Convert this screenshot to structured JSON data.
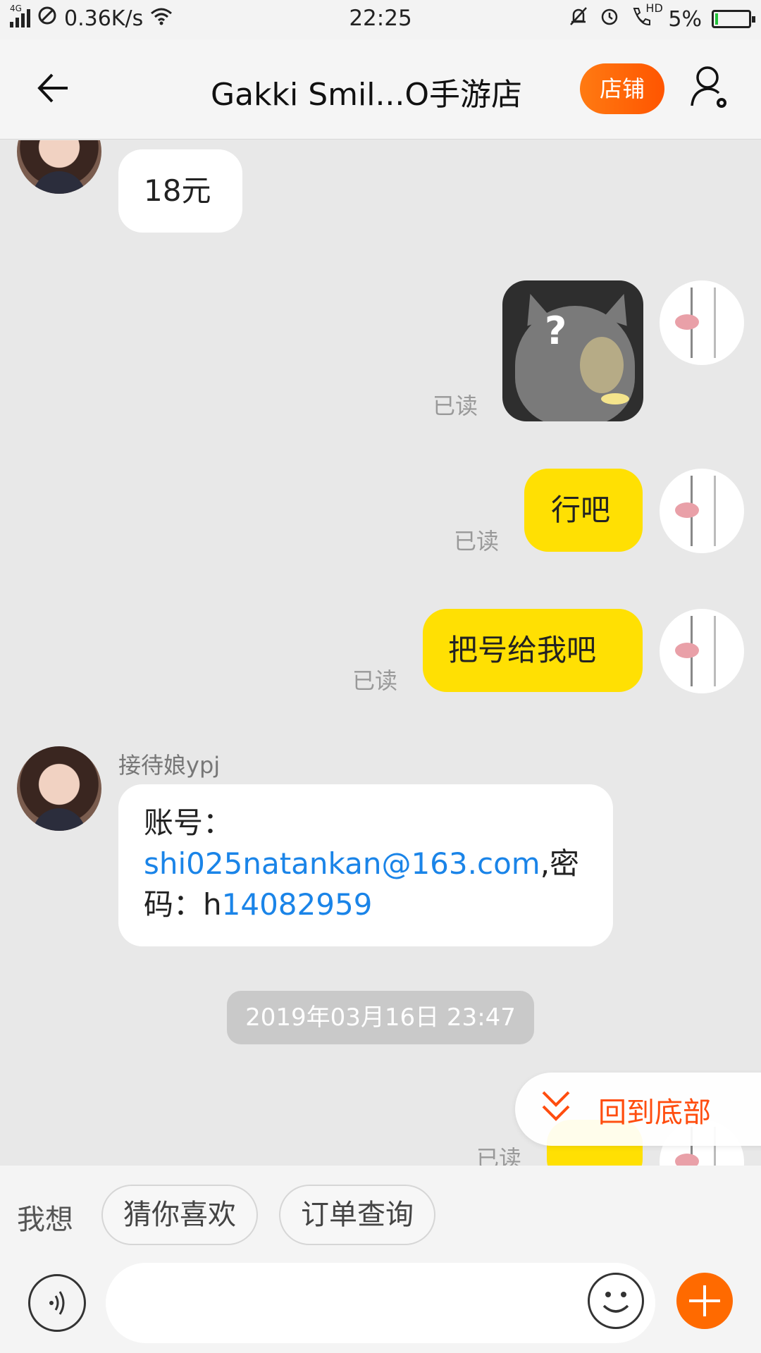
{
  "status_bar": {
    "network_type": "4G",
    "speed": "0.36K/s",
    "time": "22:25",
    "hd_label": "HD",
    "battery": "5%",
    "battery_fraction": 0.05,
    "icons": [
      "signal-icon",
      "blocked-icon",
      "wifi-icon",
      "mute-bell-icon",
      "alarm-icon",
      "hd-call-icon",
      "battery-charging-icon"
    ]
  },
  "header": {
    "title": "Gakki Smil...O手游店",
    "shop_button": "店铺",
    "icons": [
      "back-arrow-icon",
      "user-settings-icon"
    ]
  },
  "messages": [
    {
      "from": "seller",
      "text": "18元"
    },
    {
      "from": "me",
      "type": "sticker",
      "sticker_text": "?",
      "read": "已读"
    },
    {
      "from": "me",
      "text": "行吧",
      "read": "已读"
    },
    {
      "from": "me",
      "text": "把号给我吧",
      "read": "已读"
    },
    {
      "from": "seller",
      "sender": "接待娘ypj",
      "lines": [
        "账号：",
        "shi025natankan@163.com",
        ",密",
        "码：h",
        "14082959"
      ]
    },
    {
      "from": "me",
      "type": "partial",
      "read": "已读"
    }
  ],
  "timestamp": "2019年03月16日 23:47",
  "back_to_bottom": "回到底部",
  "quick_bar": {
    "label": "我想",
    "chips": [
      "猜你喜欢",
      "订单查询"
    ]
  },
  "input_bar": {
    "placeholder": "",
    "icons": [
      "voice-icon",
      "emoji-icon",
      "plus-icon"
    ]
  },
  "colors": {
    "accent": "#ff5500",
    "my_bubble": "#ffe003",
    "link": "#1a84e8",
    "background": "#e8e8e8"
  }
}
